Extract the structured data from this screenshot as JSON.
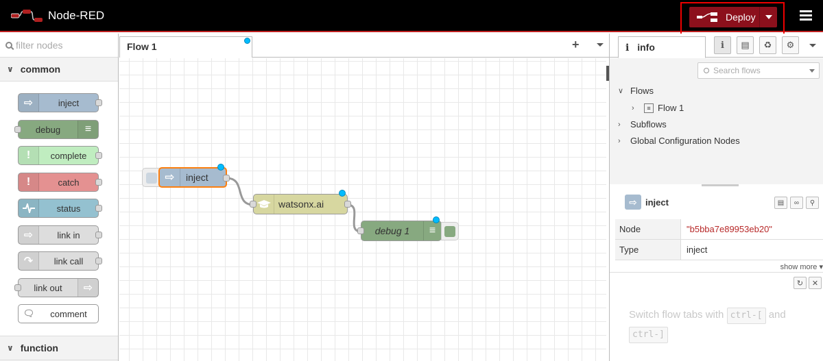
{
  "header": {
    "app_title": "Node-RED",
    "deploy_label": "Deploy",
    "brand_color": "#8c101c"
  },
  "palette": {
    "filter_placeholder": "filter nodes",
    "categories": [
      {
        "name": "common"
      },
      {
        "name": "function"
      }
    ],
    "nodes": [
      {
        "label": "inject",
        "color": "#a6bbcf"
      },
      {
        "label": "debug",
        "color": "#87a980"
      },
      {
        "label": "complete",
        "color": "#c0edc0"
      },
      {
        "label": "catch",
        "color": "#e49191"
      },
      {
        "label": "status",
        "color": "#94c1d0"
      },
      {
        "label": "link in",
        "color": "#dddddd"
      },
      {
        "label": "link call",
        "color": "#dddddd"
      },
      {
        "label": "link out",
        "color": "#dddddd"
      },
      {
        "label": "comment",
        "color": "#ffffff"
      }
    ]
  },
  "workspace": {
    "tabs": [
      {
        "label": "Flow 1"
      }
    ],
    "flow_nodes": [
      {
        "label": "inject",
        "color": "#a6bbcf"
      },
      {
        "label": "watsonx.ai",
        "color": "#d7d7a0"
      },
      {
        "label": "debug 1",
        "color": "#87a980"
      }
    ]
  },
  "sidebar": {
    "active_tab": "info",
    "search_placeholder": "Search flows",
    "tree": {
      "flows": "Flows",
      "flow1": "Flow 1",
      "subflows": "Subflows",
      "global_config": "Global Configuration Nodes"
    },
    "selected_node": {
      "title": "inject",
      "props": [
        {
          "key": "Node",
          "value": "\"b5bba7e89953eb20\""
        },
        {
          "key": "Type",
          "value": "inject"
        }
      ],
      "show_more": "show more"
    },
    "tip": {
      "text_before": "Switch flow tabs with",
      "key1": "ctrl-[",
      "text_mid": "and",
      "key2": "ctrl-]"
    }
  }
}
